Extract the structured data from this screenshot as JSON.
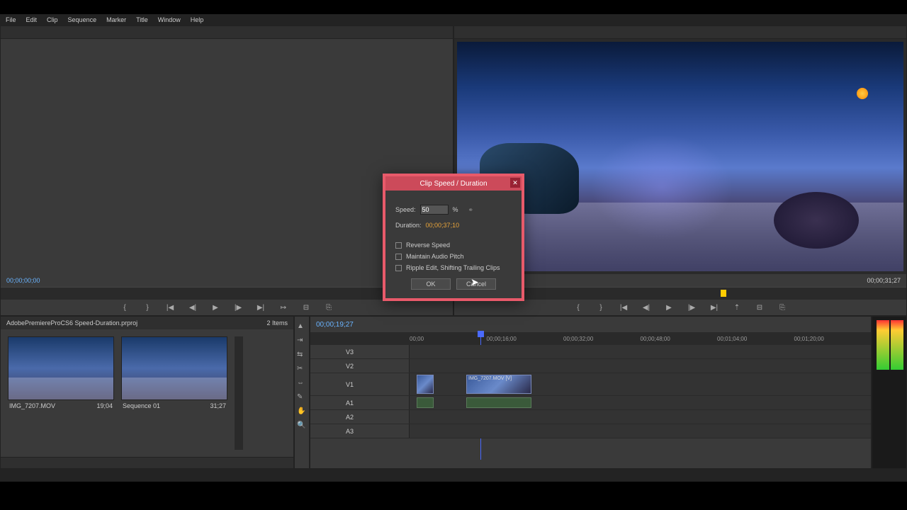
{
  "menu": [
    "File",
    "Edit",
    "Clip",
    "Sequence",
    "Marker",
    "Title",
    "Window",
    "Help"
  ],
  "source": {
    "timecode": "00;00;00;00"
  },
  "program": {
    "timecode_left": "",
    "timecode_right": "00;00;31;27"
  },
  "project": {
    "name": "AdobePremiereProCS6 Speed-Duration.prproj",
    "item_count": "2 Items",
    "bins": [
      {
        "label": "IMG_7207.MOV",
        "dur": "19;04"
      },
      {
        "label": "Sequence 01",
        "dur": "31;27"
      }
    ]
  },
  "timeline": {
    "playhead_time": "00;00;19;27",
    "ticks": [
      "00;00",
      "00;00;16;00",
      "00;00;32;00",
      "00;00;48;00",
      "00;01;04;00",
      "00;01;20;00"
    ],
    "tracks_v": [
      "V3",
      "V2",
      "V1"
    ],
    "tracks_a": [
      "A1",
      "A2",
      "A3"
    ],
    "clip_v1_label": "IMG_7207.MOV [V]"
  },
  "dialog": {
    "title": "Clip Speed / Duration",
    "speed_label": "Speed:",
    "speed_value": "50",
    "speed_pct": "%",
    "duration_label": "Duration:",
    "duration_value": "00;00;37;10",
    "reverse": "Reverse Speed",
    "maintain": "Maintain Audio Pitch",
    "ripple": "Ripple Edit, Shifting Trailing Clips",
    "ok": "OK",
    "cancel": "Cancel"
  }
}
